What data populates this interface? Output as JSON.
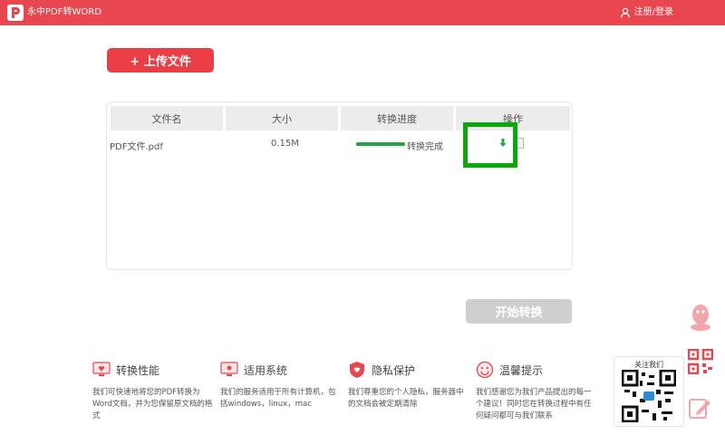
{
  "header": {
    "app_title": "永中PDF转WORD",
    "login_label": "注册/登录",
    "logo_letter": "P"
  },
  "toolbar": {
    "upload_label": "+ 上传文件"
  },
  "table": {
    "columns": [
      "文件名",
      "大小",
      "转换进度",
      "操作"
    ],
    "rows": [
      {
        "name": "PDF文件.pdf",
        "size": "0.15M",
        "progress": 1.0,
        "status": "转换完成"
      }
    ]
  },
  "actions": {
    "start_label": "开始转换"
  },
  "features": [
    {
      "title": "转换性能",
      "icon": "monitor-heart-icon",
      "desc": "我们可快速地将您的PDF转换为Word文档，并为您保留原文档的格式"
    },
    {
      "title": "适用系统",
      "icon": "monitor-system-icon",
      "desc": "我们的服务适用于所有计算机，包括windows，linux，mac"
    },
    {
      "title": "隐私保护",
      "icon": "shield-heart-icon",
      "desc": "我们尊重您的个人隐私，服务器中的文档会被定期清除"
    },
    {
      "title": "温馨提示",
      "icon": "smile-icon",
      "desc": "我们感谢您为我们产品提出的每一个建议！同时您在转换过程中有任何疑问都可与我们联系"
    }
  ],
  "sidebar": {
    "qr_label": "关注我们"
  },
  "colors": {
    "brand": "#e8474f",
    "success": "#23a446",
    "highlight": "#0aa80a"
  }
}
